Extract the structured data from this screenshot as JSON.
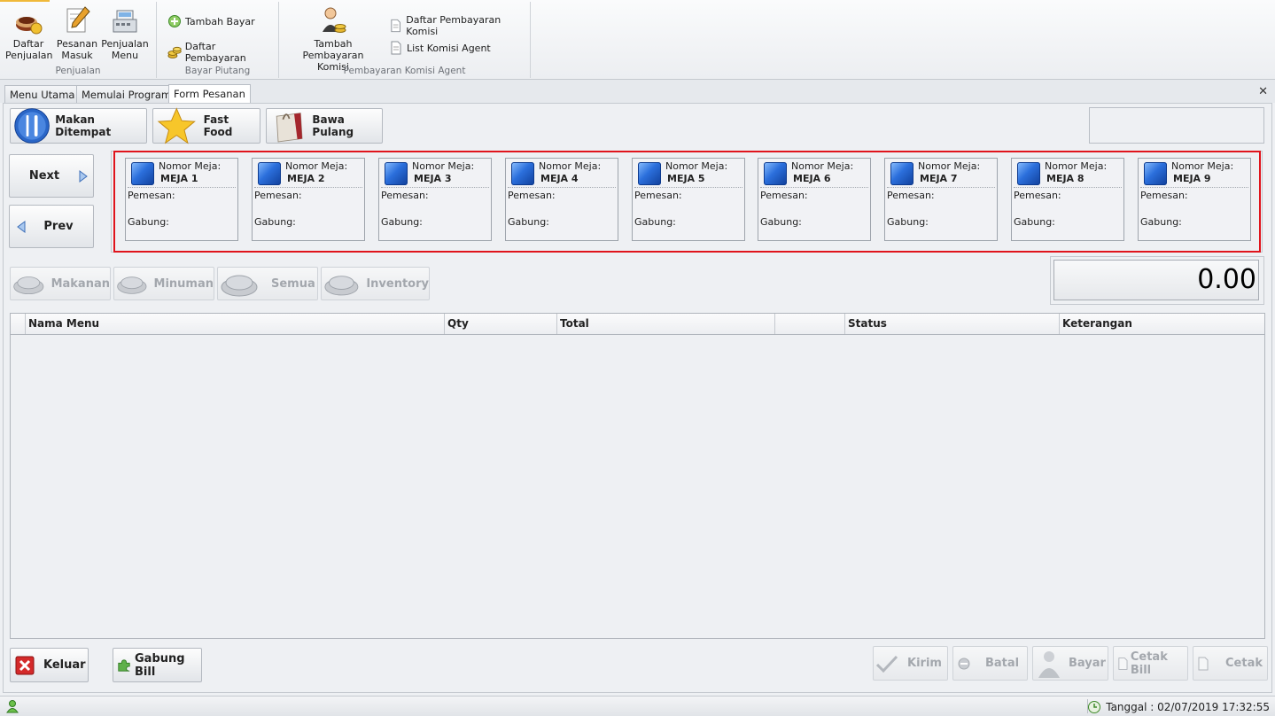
{
  "ribbon": {
    "groups": {
      "penjualan": {
        "caption": "Penjualan",
        "buttons": [
          {
            "label1": "Daftar",
            "label2": "Penjualan",
            "icon": "food-bowl-icon"
          },
          {
            "label1": "Pesanan",
            "label2": "Masuk",
            "icon": "pencil-note-icon"
          },
          {
            "label1": "Penjualan",
            "label2": "Menu",
            "icon": "cash-register-icon"
          }
        ]
      },
      "bayar_piutang": {
        "caption": "Bayar Piutang",
        "buttons": [
          {
            "label": "Tambah Bayar",
            "icon": "add-circle-icon"
          },
          {
            "label": "Daftar Pembayaran",
            "icon": "coins-icon"
          }
        ]
      },
      "komisi": {
        "caption": "Pembayaran Komisi Agent",
        "big_label1": "Tambah Pembayaran",
        "big_label2": "Komisi",
        "buttons": [
          {
            "label": "Daftar Pembayaran Komisi",
            "icon": "document-icon"
          },
          {
            "label": "List Komisi Agent",
            "icon": "document-icon"
          }
        ]
      }
    }
  },
  "tabs": [
    "Menu Utama",
    "Memulai Program",
    "Form Pesanan"
  ],
  "active_tab": "Form Pesanan",
  "order_types": [
    "Makan Ditempat",
    "Fast Food",
    "Bawa Pulang"
  ],
  "nav": {
    "next": "Next",
    "prev": "Prev"
  },
  "tables": {
    "label_nomor": "Nomor Meja:",
    "label_pemesan": "Pemesan:",
    "label_gabung": "Gabung:",
    "items": [
      "MEJA 1",
      "MEJA 2",
      "MEJA 3",
      "MEJA 4",
      "MEJA 5",
      "MEJA 6",
      "MEJA 7",
      "MEJA 8",
      "MEJA 9"
    ]
  },
  "categories": [
    "Makanan",
    "Minuman",
    "Semua",
    "Inventory"
  ],
  "total": "0.00",
  "grid": {
    "columns": [
      "Nama Menu",
      "Qty",
      "Total",
      "",
      "Status",
      "Keterangan"
    ]
  },
  "bottom": {
    "keluar": "Keluar",
    "gabung_bill": "Gabung Bill",
    "kirim": "Kirim",
    "batal": "Batal",
    "bayar": "Bayar",
    "cetak_bill": "Cetak Bill",
    "cetak": "Cetak"
  },
  "status": {
    "tanggal": "Tanggal : 02/07/2019 17:32:55"
  },
  "colors": {
    "highlight_frame": "#e0141c",
    "table_icon": "#2b6fdc"
  }
}
